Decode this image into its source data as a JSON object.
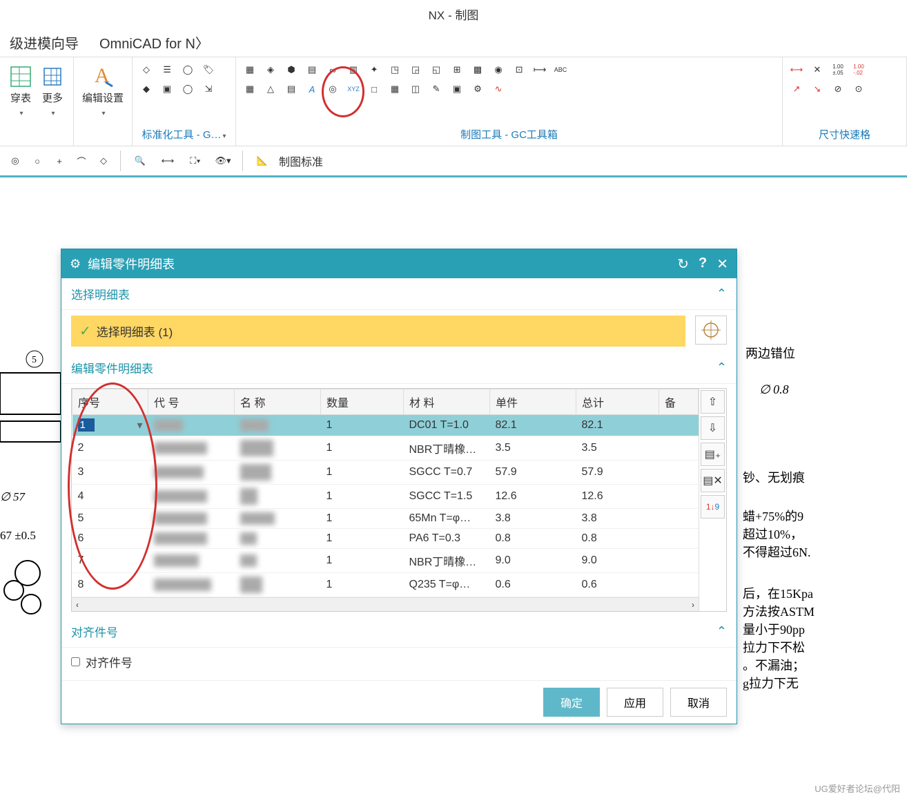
{
  "app_title": "NX - 制图",
  "menu": {
    "item1": "级进模向导",
    "item2": "OmniCAD for N〉"
  },
  "ribbon": {
    "group1": {
      "btn1": "穿表",
      "btn2": "更多"
    },
    "group2": {
      "btn1": "编辑设置"
    },
    "group3_label": "标准化工具 - G…",
    "group4_label": "制图工具 - GC工具箱",
    "group5_label": "尺寸快速格",
    "qat_label": "制图标准"
  },
  "dialog": {
    "title": "编辑零件明细表",
    "sec_select": "选择明细表",
    "selection_text": "选择明细表 (1)",
    "sec_edit": "编辑零件明细表",
    "columns": {
      "seq": "序号",
      "code": "代 号",
      "name": "名 称",
      "qty": "数量",
      "mat": "材 料",
      "unit": "单件",
      "tot": "总计",
      "note": "备"
    },
    "rows": [
      {
        "seq": "1",
        "code": "500…",
        "name": "… (…",
        "qty": "1",
        "mat": "DC01 T=1.0",
        "unit": "82.1",
        "tot": "82.1"
      },
      {
        "seq": "2",
        "code": "5011 .0 -…",
        "name": "…围…",
        "qty": "1",
        "mat": "NBR丁晴橡…",
        "unit": "3.5",
        "tot": "3.5"
      },
      {
        "seq": "3",
        "code": "501 … -…",
        "name": "5 主…",
        "qty": "1",
        "mat": "SGCC T=0.7",
        "unit": "57.9",
        "tot": "57.9"
      },
      {
        "seq": "4",
        "code": "501 …2-…",
        "name": "轮 )",
        "qty": "1",
        "mat": "SGCC T=1.5",
        "unit": "12.6",
        "tot": "12.6"
      },
      {
        "seq": "5",
        "code": "501 …2-…",
        "name": "1… (…",
        "qty": "1",
        "mat": "65Mn T=φ…",
        "unit": "3.8",
        "tot": "3.8"
      },
      {
        "seq": "6",
        "code": "501 …7-…",
        "name": "1…",
        "qty": "1",
        "mat": "PA6 T=0.3",
        "unit": "0.8",
        "tot": "0.8"
      },
      {
        "seq": "7",
        "code": "501 2 -…",
        "name": "1…",
        "qty": "1",
        "mat": "NBR丁晴橡…",
        "unit": "9.0",
        "tot": "9.0"
      },
      {
        "seq": "8",
        "code": "500 .007-…",
        "name": "回…",
        "qty": "1",
        "mat": "Q235 T=φ…",
        "unit": "0.6",
        "tot": "0.6"
      }
    ],
    "sec_align": "对齐件号",
    "checkbox_align": "对齐件号",
    "btn_ok": "确定",
    "btn_apply": "应用",
    "btn_cancel": "取消"
  },
  "bg": {
    "note1": "两边错位",
    "dim1": "∅ 0.8",
    "note2": "钞、无划痕",
    "note3": "蜡+75%的9",
    "note4": "超过10%，",
    "note5": "不得超过6N.",
    "note6": "后，在15Kpa",
    "note7": "方法按ASTM",
    "note8": "量小于90pp",
    "note9": "拉力下不松",
    "note10": "。不漏油；",
    "note11": "g拉力下无",
    "dim2": "∅ 57",
    "dim3": "67 ±0.5",
    "balloon5": "5"
  },
  "watermark": "UG爱好者论坛@代阳"
}
